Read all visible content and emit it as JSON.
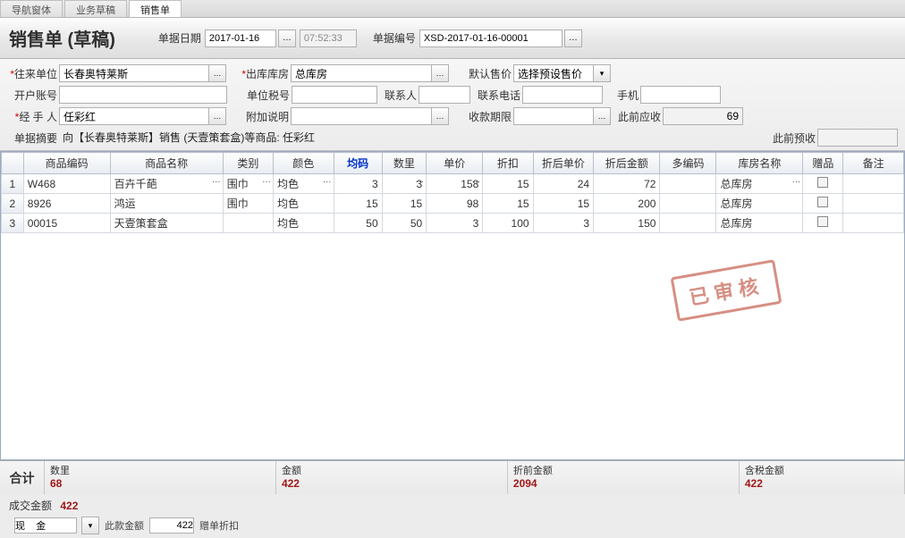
{
  "tabs": [
    "导航窗体",
    "业务草稿",
    "销售单"
  ],
  "activeTab": 2,
  "title": "销售单 (草稿)",
  "header": {
    "dateLabel": "单据日期",
    "date": "2017-01-16",
    "time": "07:52:33",
    "noLabel": "单据编号",
    "no": "XSD-2017-01-16-00001"
  },
  "form": {
    "partnerLabel": "往来单位",
    "partner": "长春奥特莱斯",
    "outWhLabel": "出库库房",
    "outWh": "总库房",
    "defPriceLabel": "默认售价",
    "defPrice": "选择预设售价",
    "bankLabel": "开户账号",
    "bank": "",
    "taxLabel": "单位税号",
    "tax": "",
    "contactLabel": "联系人",
    "contact": "",
    "phoneLabel": "联系电话",
    "phone": "",
    "mobileLabel": "手机",
    "mobile": "",
    "handlerLabel": "经 手 人",
    "handler": "任彩红",
    "extraLabel": "附加说明",
    "extra": "",
    "dueLabel": "收款期限",
    "due": "",
    "prevRecvLabel": "此前应收",
    "prevRecv": "69",
    "prevPreLabel": "此前预收",
    "prevPre": "",
    "summaryLabel": "单据摘要",
    "summary": "向【长春奥特莱斯】销售 (天壹策套盒)等商品: 任彩红"
  },
  "cols": [
    "",
    "商品编码",
    "商品名称",
    "类别",
    "颜色",
    "均码",
    "数里",
    "单价",
    "折扣",
    "折后单价",
    "折后金额",
    "多编码",
    "库房名称",
    "赠品",
    "备注"
  ],
  "hlCol": 5,
  "rows": [
    {
      "n": "1",
      "code": "W468",
      "name": "百卉千葩",
      "cat": "围巾",
      "color": "均色",
      "size": "3",
      "qty": "3",
      "price": "158",
      "disc": "15",
      "dprice": "24",
      "amt": "72",
      "multi": "",
      "wh": "总库房",
      "gift": false,
      "note": "",
      "ell": true
    },
    {
      "n": "2",
      "code": "8926",
      "name": "鸿运",
      "cat": "围巾",
      "color": "均色",
      "size": "15",
      "qty": "15",
      "price": "98",
      "disc": "15",
      "dprice": "15",
      "amt": "200",
      "multi": "",
      "wh": "总库房",
      "gift": false,
      "note": "",
      "ell": false
    },
    {
      "n": "3",
      "code": "00015",
      "name": "天壹策套盒",
      "cat": "",
      "color": "均色",
      "size": "50",
      "qty": "50",
      "price": "3",
      "disc": "100",
      "dprice": "3",
      "amt": "150",
      "multi": "",
      "wh": "总库房",
      "gift": false,
      "note": "",
      "ell": false
    }
  ],
  "stamp": "已审核",
  "totals": {
    "label": "合计",
    "qtyLabel": "数里",
    "qty": "68",
    "amtLabel": "金额",
    "amt": "422",
    "preAmtLabel": "折前金额",
    "preAmt": "2094",
    "taxAmtLabel": "含税金额",
    "taxAmt": "422"
  },
  "footer": {
    "dealLabel": "成交金额",
    "deal": "422",
    "line2a": "",
    "line2inA": "现    金",
    "line2b": "此款金额",
    "line2inB": "422",
    "line2c": "赠单折扣"
  }
}
